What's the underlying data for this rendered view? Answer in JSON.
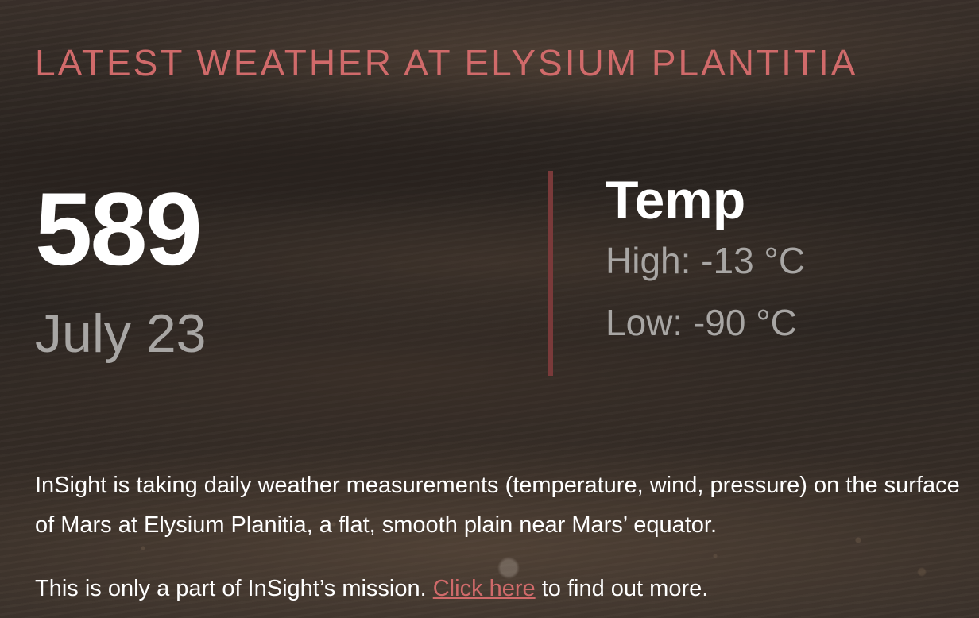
{
  "headline": "LATEST WEATHER AT ELYSIUM PLANTITIA",
  "sol": {
    "number": "589",
    "date": "July 23"
  },
  "temperature": {
    "title": "Temp",
    "high": "High: -13 °C",
    "low": "Low: -90 °C"
  },
  "description": "InSight is taking daily weather measurements (temperature, wind, pressure) on the surface of Mars at Elysium Planitia, a flat, smooth plain near Mars’ equator.",
  "more_info": {
    "prefix": "This is only a part of InSight’s mission. ",
    "link_text": "Click here",
    "suffix": " to find out more."
  },
  "colors": {
    "accent": "#d06a6a",
    "divider": "#7a3a3a",
    "muted_text": "#a8a6a4"
  }
}
